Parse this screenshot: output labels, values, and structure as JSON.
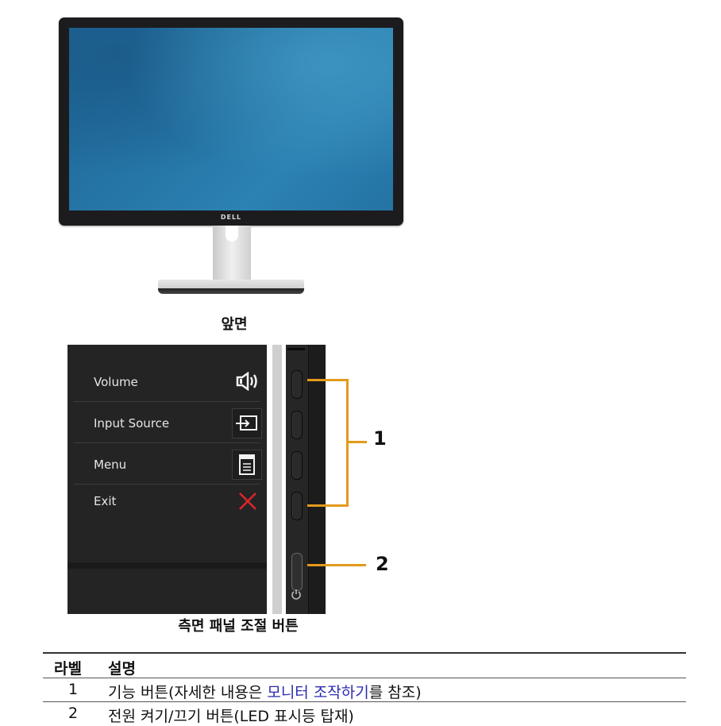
{
  "front_view": {
    "brand_logo": "DELL",
    "caption": "앞면"
  },
  "side_view": {
    "caption": "측면 패널 조절 버튼",
    "osd_menu": [
      {
        "label": "Volume",
        "icon": "volume-icon"
      },
      {
        "label": "Input Source",
        "icon": "input-source-icon"
      },
      {
        "label": "Menu",
        "icon": "menu-icon"
      },
      {
        "label": "Exit",
        "icon": "close-icon"
      }
    ],
    "callouts": [
      "1",
      "2"
    ],
    "colors": {
      "callout": "#e39a1c",
      "exit_icon": "#d9262c"
    }
  },
  "table": {
    "headers": [
      "라벨",
      "설명"
    ],
    "rows": [
      {
        "label": "1",
        "desc_prefix": "기능 버튼(자세한 내용은 ",
        "desc_link": "모니터 조작하기",
        "desc_suffix": "를 참조)"
      },
      {
        "label": "2",
        "desc_prefix": "전원 켜기/끄기 버튼(LED 표시등 탑재)",
        "desc_link": "",
        "desc_suffix": ""
      }
    ],
    "link_color": "#2b2bb0"
  }
}
